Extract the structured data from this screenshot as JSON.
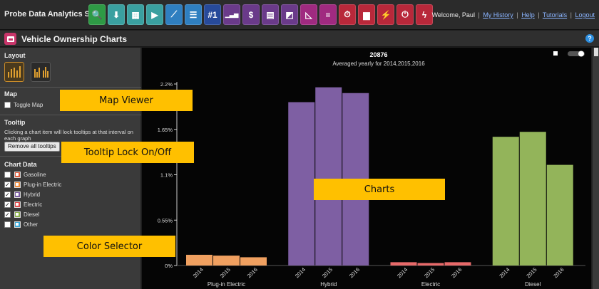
{
  "topbar": {
    "suite_title": "Probe Data Analytics Suite",
    "tools": [
      {
        "icon": "search-icon",
        "color": "#2e9a45",
        "glyph": "🔍"
      },
      {
        "icon": "download-icon",
        "color": "#3aa0a0",
        "glyph": "⬇"
      },
      {
        "icon": "traffic-signal-icon",
        "color": "#3aa0a0",
        "glyph": "▦"
      },
      {
        "icon": "play-icon",
        "color": "#3aa0a0",
        "glyph": "▶"
      },
      {
        "icon": "trend-line-icon",
        "color": "#2f7fc0",
        "glyph": "⟋"
      },
      {
        "icon": "list-icon",
        "color": "#2f7fc0",
        "glyph": "☰"
      },
      {
        "icon": "rank-number-icon",
        "color": "#274a9a",
        "glyph": "#1"
      },
      {
        "icon": "bar-chart-icon",
        "color": "#6a3a8a",
        "glyph": "▁▃▅"
      },
      {
        "icon": "dollar-icon",
        "color": "#6a3a8a",
        "glyph": "$"
      },
      {
        "icon": "report-icon",
        "color": "#6a3a8a",
        "glyph": "▤"
      },
      {
        "icon": "us-map-icon",
        "color": "#6a3a8a",
        "glyph": "◩"
      },
      {
        "icon": "triangle-chart-icon",
        "color": "#a02a80",
        "glyph": "◺"
      },
      {
        "icon": "menu-lines-icon",
        "color": "#a02a80",
        "glyph": "≡"
      },
      {
        "icon": "stopwatch-icon",
        "color": "#b8283a",
        "glyph": "⏱"
      },
      {
        "icon": "vehicle-icon",
        "color": "#b8283a",
        "glyph": "▆"
      },
      {
        "icon": "lightning-icon",
        "color": "#b8283a",
        "glyph": "⚡"
      },
      {
        "icon": "power-icon",
        "color": "#b8283a",
        "glyph": "⏻"
      },
      {
        "icon": "energy-icon",
        "color": "#b8283a",
        "glyph": "ϟ"
      }
    ],
    "welcome": "Welcome, Paul",
    "links": [
      "My History",
      "Help",
      "Tutorials",
      "Logout"
    ]
  },
  "titlebar": {
    "title": "Vehicle Ownership Charts",
    "help_icon": "?"
  },
  "sidebar": {
    "layout_title": "Layout",
    "map_title": "Map",
    "toggle_map_label": "Toggle Map",
    "toggle_map_checked": false,
    "tooltip_title": "Tooltip",
    "tooltip_desc": "Clicking a chart item will lock tooltips at that interval on each graph",
    "remove_tooltips_label": "Remove all tooltips",
    "chart_data_title": "Chart Data",
    "chart_data": [
      {
        "label": "Gasoline",
        "checked": false,
        "color": "#e05a3a"
      },
      {
        "label": "Plug-in Electric",
        "checked": true,
        "color": "#f08a3a"
      },
      {
        "label": "Hybrid",
        "checked": true,
        "color": "#7a5ba0"
      },
      {
        "label": "Electric",
        "checked": true,
        "color": "#e04a4a"
      },
      {
        "label": "Diesel",
        "checked": true,
        "color": "#8ab04a"
      },
      {
        "label": "Other",
        "checked": false,
        "color": "#38a8d8"
      }
    ]
  },
  "callouts": {
    "map_viewer": "Map Viewer",
    "tooltip_lock": "Tooltip Lock On/Off",
    "charts": "Charts",
    "color_selector": "Color Selector"
  },
  "chart_data": {
    "type": "bar",
    "title": "20876",
    "subtitle": "Averaged yearly for 2014,2015,2016",
    "ylim": [
      0,
      2.2
    ],
    "yticks": [
      "0%",
      "0.55%",
      "1.1%",
      "1.65%",
      "2.2%"
    ],
    "groups": [
      "Plug-in Electric",
      "Hybrid",
      "Electric",
      "Diesel"
    ],
    "categories": [
      "2014",
      "2015",
      "2016"
    ],
    "series": [
      {
        "name": "Plug-in Electric",
        "color": "#f0a060",
        "values": [
          0.13,
          0.12,
          0.1
        ]
      },
      {
        "name": "Hybrid",
        "color": "#7e5fa3",
        "values": [
          1.98,
          2.16,
          2.09
        ]
      },
      {
        "name": "Electric",
        "color": "#e86a6a",
        "values": [
          0.04,
          0.03,
          0.04
        ]
      },
      {
        "name": "Diesel",
        "color": "#93b45a",
        "values": [
          1.56,
          1.62,
          1.22
        ]
      }
    ]
  }
}
